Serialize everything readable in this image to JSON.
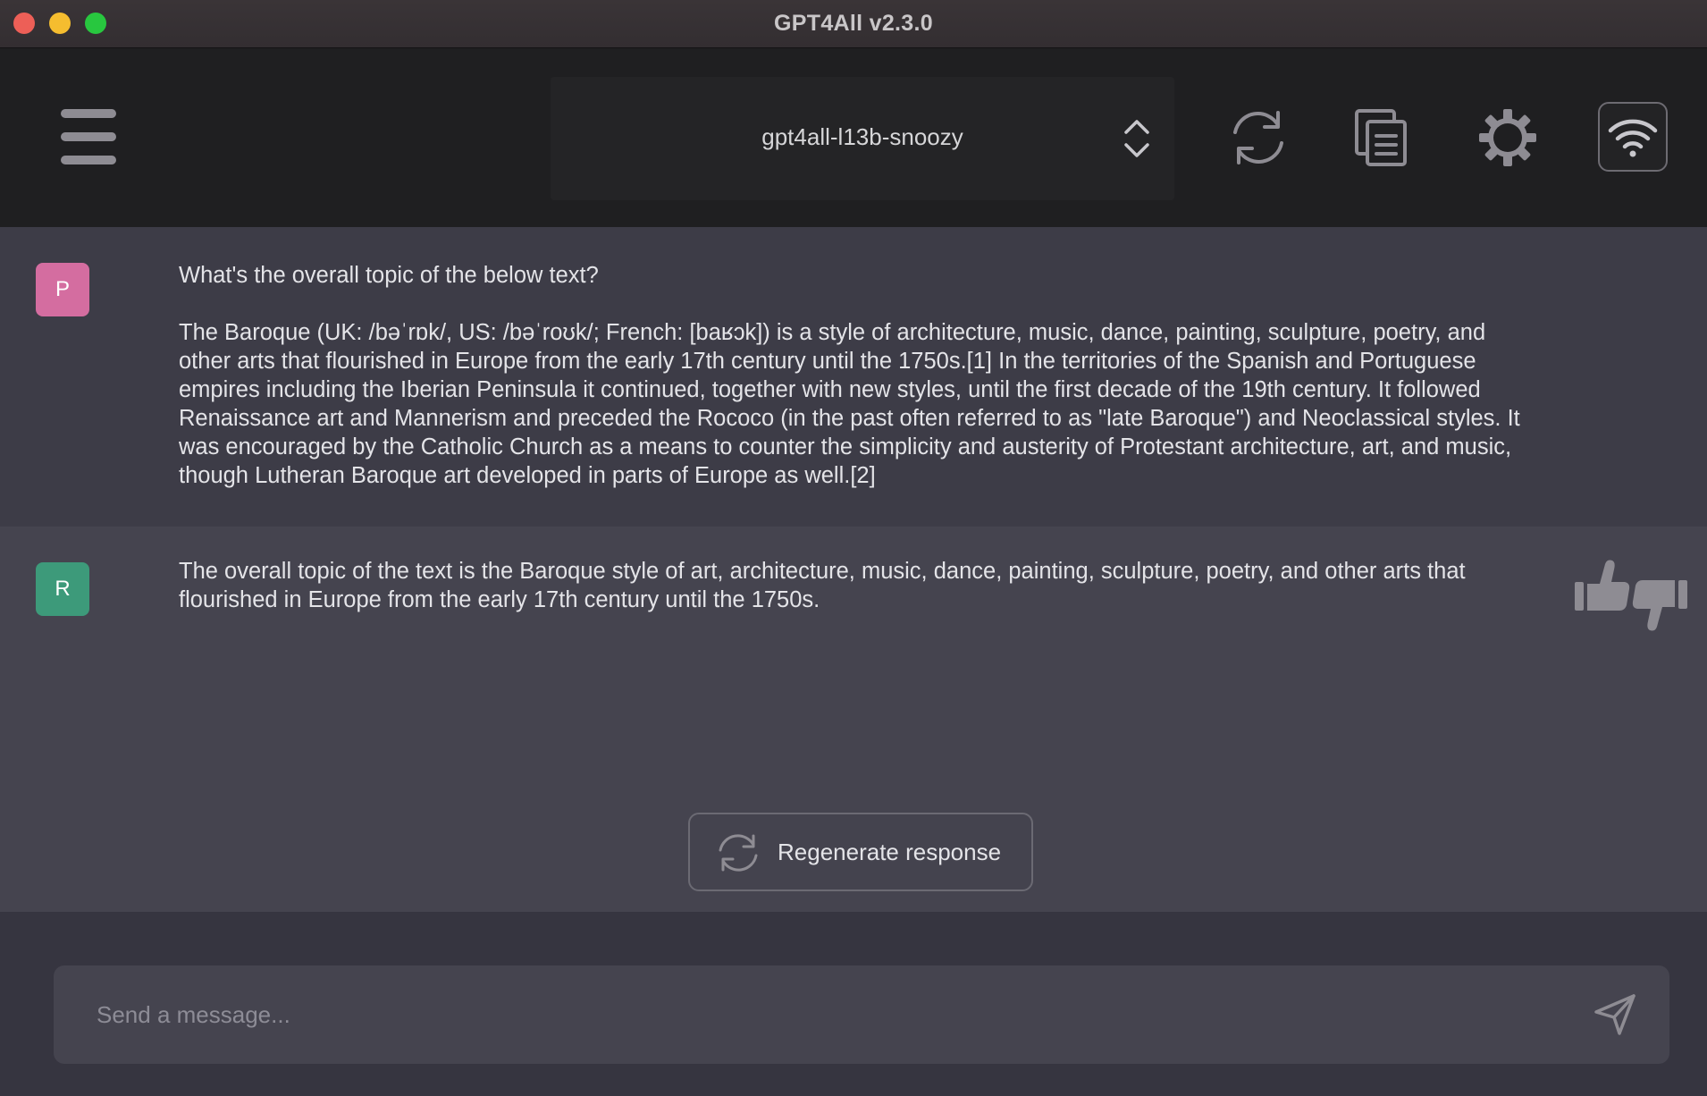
{
  "window": {
    "title": "GPT4All v2.3.0"
  },
  "toolbar": {
    "model": "gpt4all-l13b-snoozy",
    "icons": [
      "menu-icon",
      "chevron-updown-icon",
      "reset-context-icon",
      "copy-conversation-icon",
      "settings-icon",
      "network-icon"
    ]
  },
  "conversation": {
    "prompt": {
      "avatar": "P",
      "avatar_color": "#d46da0",
      "question": "What's the overall topic of the below text?",
      "body": "The Baroque (UK: /bəˈrɒk/, US: /bəˈroʊk/; French: [baʁɔk]) is a style of architecture, music, dance, painting, sculpture, poetry, and other arts that flourished in Europe from the early 17th century until the 1750s.[1] In the territories of the Spanish and Portuguese empires including the Iberian Peninsula it continued, together with new styles, until the first decade of the 19th century. It followed Renaissance art and Mannerism and preceded the Rococo (in the past often referred to as \"late Baroque\") and Neoclassical styles. It was encouraged by the Catholic Church as a means to counter the simplicity and austerity of Protestant architecture, art, and music, though Lutheran Baroque art developed in parts of Europe as well.[2]"
    },
    "response": {
      "avatar": "R",
      "avatar_color": "#3d9a7a",
      "text": "The overall topic of the text is the Baroque style of art, architecture, music, dance, painting, sculpture, poetry, and other arts that flourished in Europe from the early 17th century until the 1750s.",
      "feedback_icons": [
        "thumbs-up-icon",
        "thumbs-down-icon"
      ]
    },
    "regenerate_label": "Regenerate response"
  },
  "input": {
    "placeholder": "Send a message...",
    "value": ""
  }
}
